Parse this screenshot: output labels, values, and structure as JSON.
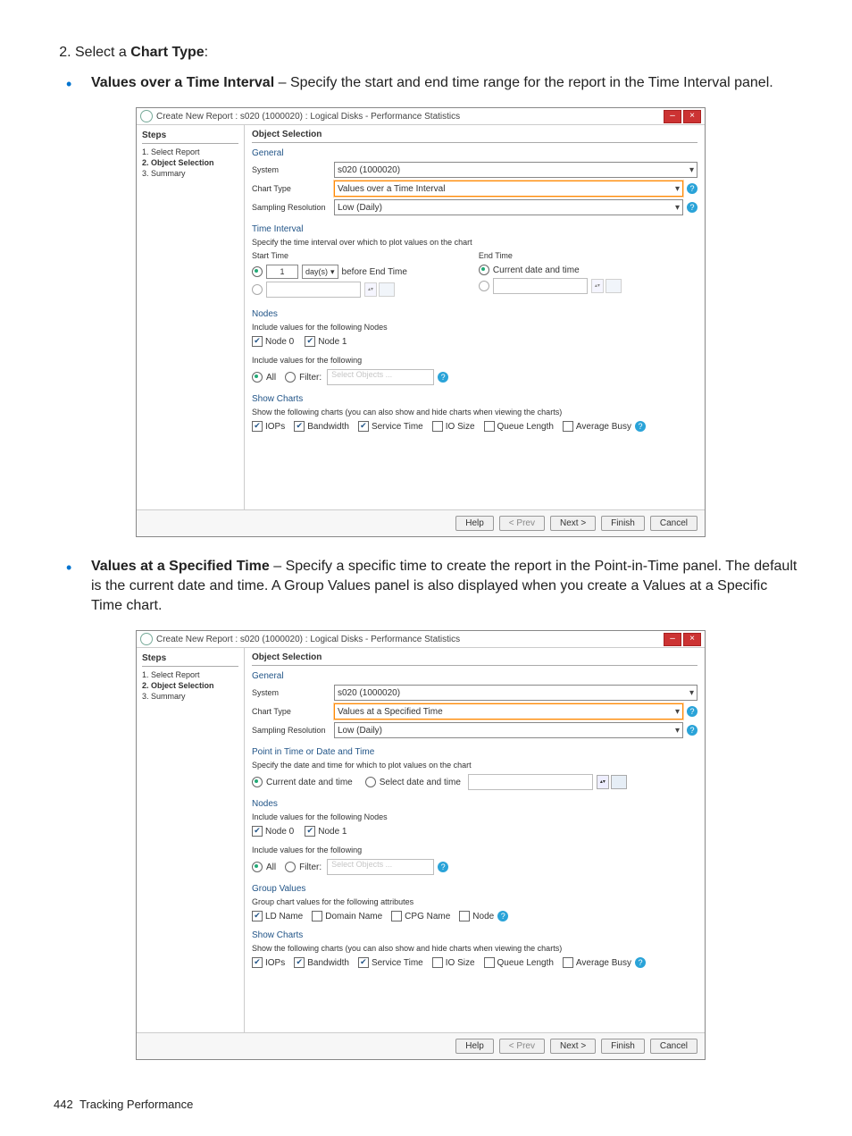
{
  "instruction": {
    "number": "2.",
    "text_prefix": "Select a ",
    "bold": "Chart Type",
    "suffix": ":"
  },
  "bullets": [
    {
      "bold": "Values over a Time Interval",
      "rest": " – Specify the start and end time range for the report in the Time Interval panel."
    },
    {
      "bold": "Values at a Specified Time",
      "rest": " – Specify a specific time to create the report in the Point-in-Time panel. The default is the current date and time. A Group Values panel is also displayed when you create a Values at a Specific Time chart."
    }
  ],
  "dialog_title": "Create New Report : s020 (1000020) : Logical Disks - Performance Statistics",
  "steps_header": "Steps",
  "steps": [
    "1. Select Report",
    "2. Object Selection",
    "3. Summary"
  ],
  "main_header": "Object Selection",
  "general": {
    "label": "General",
    "system_label": "System",
    "system_value": "s020 (1000020)",
    "chart_type_label": "Chart Type",
    "sampling_label": "Sampling Resolution",
    "sampling_value": "Low (Daily)"
  },
  "chart_types": {
    "time_interval": "Values over a Time Interval",
    "specified_time": "Values at a Specified Time"
  },
  "time_interval": {
    "label": "Time Interval",
    "desc": "Specify the time interval over which to plot values on the chart",
    "start_label": "Start Time",
    "end_label": "End Time",
    "start_val": "1",
    "units": "day(s)",
    "before": "before End Time",
    "end_current": "Current date and time"
  },
  "point_in_time": {
    "label": "Point in Time or Date and Time",
    "desc": "Specify the date and time for which to plot values on the chart",
    "current": "Current date and time",
    "select": "Select date and time"
  },
  "nodes": {
    "label": "Nodes",
    "desc": "Include values for the following Nodes",
    "n0": "Node 0",
    "n1": "Node 1"
  },
  "include": {
    "desc": "Include values for the following",
    "all": "All",
    "filter": "Filter:",
    "placeholder": "Select Objects ..."
  },
  "group_values": {
    "label": "Group Values",
    "desc": "Group chart values for the following attributes",
    "items": [
      "LD Name",
      "Domain Name",
      "CPG Name",
      "Node"
    ]
  },
  "show_charts": {
    "label": "Show Charts",
    "desc": "Show the following charts (you can also show and hide charts when viewing the charts)",
    "items": [
      "IOPs",
      "Bandwidth",
      "Service Time",
      "IO Size",
      "Queue Length",
      "Average Busy"
    ]
  },
  "buttons": {
    "help": "Help",
    "prev": "< Prev",
    "next": "Next >",
    "finish": "Finish",
    "cancel": "Cancel"
  },
  "footer": {
    "page": "442",
    "section": "Tracking Performance"
  }
}
